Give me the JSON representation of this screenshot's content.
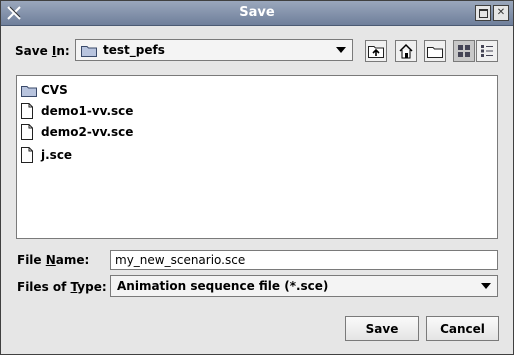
{
  "window": {
    "title": "Save"
  },
  "save_in": {
    "label_pre": "Save ",
    "label_mn": "I",
    "label_post": "n:",
    "value": "test_pefs"
  },
  "files": [
    {
      "name": "CVS",
      "icon": "folder-icon"
    },
    {
      "name": "demo1-vv.sce",
      "icon": "file-icon"
    },
    {
      "name": "demo2-vv.sce",
      "icon": "file-icon"
    },
    {
      "name": "j.sce",
      "icon": "file-icon"
    }
  ],
  "file_name": {
    "label_pre": "File ",
    "label_mn": "N",
    "label_post": "ame:",
    "value": "my_new_scenario.sce"
  },
  "file_type": {
    "label_pre": "Files of ",
    "label_mn": "T",
    "label_post": "ype:",
    "value": "Animation sequence file (*.sce)"
  },
  "buttons": {
    "save": "Save",
    "cancel": "Cancel"
  },
  "colors": {
    "titlebar": "#7f8ba6",
    "folder": "#b8c4de"
  }
}
